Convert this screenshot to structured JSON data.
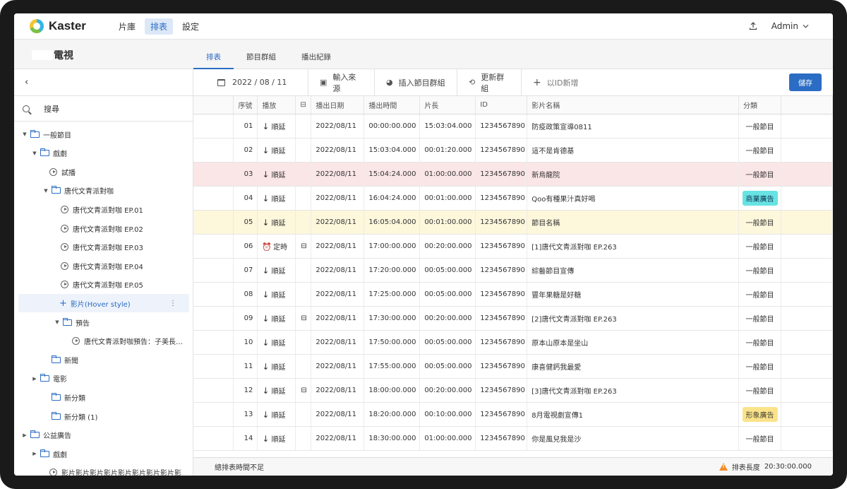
{
  "app": {
    "logo_text": "Kaster",
    "nav": [
      "片庫",
      "排表",
      "設定"
    ],
    "active_nav": "排表",
    "user": "Admin"
  },
  "channel": {
    "name": "電視"
  },
  "tabs": [
    "排表",
    "節目群組",
    "播出紀錄"
  ],
  "sidebar": {
    "back": "‹",
    "search_label": "搜尋",
    "tree": [
      {
        "label": "一般節目",
        "type": "folder",
        "depth": 0,
        "expanded": true
      },
      {
        "label": "戲劇",
        "type": "folder",
        "depth": 1,
        "expanded": true
      },
      {
        "label": "試播",
        "type": "video",
        "depth": 2
      },
      {
        "label": "唐代文青派對咖",
        "type": "folder",
        "depth": 2,
        "expanded": true
      },
      {
        "label": "唐代文青派對咖 EP.01",
        "type": "video",
        "depth": 3
      },
      {
        "label": "唐代文青派對咖 EP.02",
        "type": "video",
        "depth": 3
      },
      {
        "label": "唐代文青派對咖 EP.03",
        "type": "video",
        "depth": 3
      },
      {
        "label": "唐代文青派對咖 EP.04",
        "type": "video",
        "depth": 3
      },
      {
        "label": "唐代文青派對咖 EP.05",
        "type": "video",
        "depth": 3
      },
      {
        "label": "影片(Hover style)",
        "type": "add",
        "depth": 3
      },
      {
        "label": "預告",
        "type": "folder",
        "depth": 3,
        "expanded": true
      },
      {
        "label": "唐代文青派對咖預告：子美長…",
        "type": "video",
        "depth": 4
      },
      {
        "label": "新聞",
        "type": "folder",
        "depth": 2
      },
      {
        "label": "電影",
        "type": "folder",
        "depth": 1,
        "expanded": false
      },
      {
        "label": "新分類",
        "type": "folder",
        "depth": 2
      },
      {
        "label": "新分類 (1)",
        "type": "folder",
        "depth": 2
      },
      {
        "label": "公益廣告",
        "type": "folder",
        "depth": 0,
        "expanded": false
      },
      {
        "label": "戲劇",
        "type": "folder",
        "depth": 1,
        "expanded": false
      },
      {
        "label": "影片影片影片影片影片影片影片影片影",
        "type": "video",
        "depth": 2
      }
    ]
  },
  "toolbar": {
    "date": "2022 / 08 / 11",
    "import": "輸入來源",
    "insert_group": "插入節目群組",
    "update_group": "更新群組",
    "add_by_id": "以ID新增",
    "save": "儲存"
  },
  "table": {
    "headers": [
      "序號",
      "播放",
      "",
      "播出日期",
      "播出時間",
      "片長",
      "ID",
      "影片名稱",
      "分類"
    ],
    "rows": [
      {
        "no": "01",
        "play": "順延",
        "icon": "",
        "date": "2022/08/11",
        "time": "00:00:00.000",
        "dur": "15:03:04.000",
        "id": "1234567890",
        "name": "防疫政策宣導0811",
        "cat": "一般節目",
        "badge": "",
        "hl": ""
      },
      {
        "no": "02",
        "play": "順延",
        "icon": "",
        "date": "2022/08/11",
        "time": "15:03:04.000",
        "dur": "00:01:20.000",
        "id": "1234567890",
        "name": "這不是肯德基",
        "cat": "一般節目",
        "badge": "",
        "hl": ""
      },
      {
        "no": "03",
        "play": "順延",
        "icon": "",
        "date": "2022/08/11",
        "time": "15:04:24.000",
        "dur": "01:00:00.000",
        "id": "1234567890",
        "name": "新烏龍院",
        "cat": "一般節目",
        "badge": "",
        "hl": "red"
      },
      {
        "no": "04",
        "play": "順延",
        "icon": "",
        "date": "2022/08/11",
        "time": "16:04:24.000",
        "dur": "00:01:00.000",
        "id": "1234567890",
        "name": "Qoo有種果汁真好喝",
        "cat": "商業廣告",
        "badge": "cyan",
        "hl": ""
      },
      {
        "no": "05",
        "play": "順延",
        "icon": "",
        "date": "2022/08/11",
        "time": "16:05:04.000",
        "dur": "00:01:00.000",
        "id": "1234567890",
        "name": "節目名稱",
        "cat": "一般節目",
        "badge": "",
        "hl": "yel"
      },
      {
        "no": "06",
        "play": "定時",
        "icon": "group",
        "date": "2022/08/11",
        "time": "17:00:00.000",
        "dur": "00:20:00.000",
        "id": "1234567890",
        "name": "[1]唐代文青派對咖 EP.263",
        "cat": "一般節目",
        "badge": "",
        "hl": ""
      },
      {
        "no": "07",
        "play": "順延",
        "icon": "",
        "date": "2022/08/11",
        "time": "17:20:00.000",
        "dur": "00:05:00.000",
        "id": "1234567890",
        "name": "綜藝節目宣傳",
        "cat": "一般節目",
        "badge": "",
        "hl": ""
      },
      {
        "no": "08",
        "play": "順延",
        "icon": "",
        "date": "2022/08/11",
        "time": "17:25:00.000",
        "dur": "00:05:00.000",
        "id": "1234567890",
        "name": "豐年果糖是好糖",
        "cat": "一般節目",
        "badge": "",
        "hl": ""
      },
      {
        "no": "09",
        "play": "順延",
        "icon": "group",
        "date": "2022/08/11",
        "time": "17:30:00.000",
        "dur": "00:20:00.000",
        "id": "1234567890",
        "name": "[2]唐代文青派對咖 EP.263",
        "cat": "一般節目",
        "badge": "",
        "hl": ""
      },
      {
        "no": "10",
        "play": "順延",
        "icon": "",
        "date": "2022/08/11",
        "time": "17:50:00.000",
        "dur": "00:05:00.000",
        "id": "1234567890",
        "name": "原本山原本是坐山",
        "cat": "一般節目",
        "badge": "",
        "hl": ""
      },
      {
        "no": "11",
        "play": "順延",
        "icon": "",
        "date": "2022/08/11",
        "time": "17:55:00.000",
        "dur": "00:05:00.000",
        "id": "1234567890",
        "name": "康喜健鈣我最愛",
        "cat": "一般節目",
        "badge": "",
        "hl": ""
      },
      {
        "no": "12",
        "play": "順延",
        "icon": "group",
        "date": "2022/08/11",
        "time": "18:00:00.000",
        "dur": "00:20:00.000",
        "id": "1234567890",
        "name": "[3]唐代文青派對咖 EP.263",
        "cat": "一般節目",
        "badge": "",
        "hl": ""
      },
      {
        "no": "13",
        "play": "順延",
        "icon": "",
        "date": "2022/08/11",
        "time": "18:20:00.000",
        "dur": "00:10:00.000",
        "id": "1234567890",
        "name": "8月電視劇宣傳1",
        "cat": "形象廣告",
        "badge": "yel",
        "hl": ""
      },
      {
        "no": "14",
        "play": "順延",
        "icon": "",
        "date": "2022/08/11",
        "time": "18:30:00.000",
        "dur": "01:00:00.000",
        "id": "1234567890",
        "name": "你是風兒我是沙",
        "cat": "一般節目",
        "badge": "",
        "hl": ""
      }
    ]
  },
  "footer": {
    "warning": "總排表時間不足",
    "length_label": "排表長度",
    "length_value": "20:30:00.000"
  }
}
